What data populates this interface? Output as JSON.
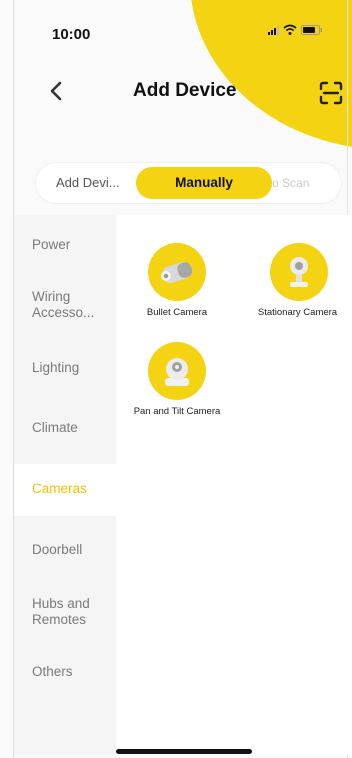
{
  "status_bar": {
    "time": "10:00"
  },
  "header": {
    "title": "Add Device",
    "back_icon": "chevron-left-icon",
    "scan_icon": "scan-icon"
  },
  "tabs": [
    {
      "label": "Add Devi...",
      "active": false
    },
    {
      "label": "Manually",
      "active": true
    },
    {
      "label": "Auto Scan",
      "active": false
    }
  ],
  "sidebar": {
    "items": [
      {
        "label": "Power"
      },
      {
        "label": "Wiring Accesso..."
      },
      {
        "label": "Lighting"
      },
      {
        "label": "Climate"
      },
      {
        "label": "Cameras",
        "active": true
      },
      {
        "label": "Doorbell"
      },
      {
        "label": "Hubs and Remotes"
      },
      {
        "label": "Others"
      }
    ]
  },
  "devices": [
    {
      "label": "Bullet Camera",
      "icon": "bullet-camera-icon"
    },
    {
      "label": "Stationary Camera",
      "icon": "stationary-camera-icon"
    },
    {
      "label": "Pan and Tilt Camera",
      "icon": "pan-tilt-camera-icon"
    }
  ],
  "colors": {
    "accent": "#f4d313",
    "active_text": "#f2c200"
  }
}
